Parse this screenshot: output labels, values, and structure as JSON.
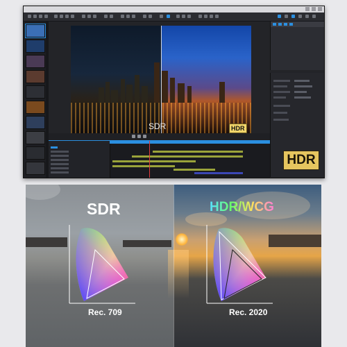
{
  "editor": {
    "menu": [
      "",
      "",
      "",
      "",
      "",
      "",
      "",
      "",
      ""
    ],
    "preview_left_label": "SDR",
    "preview_right_badge": "HDR"
  },
  "corner_badge": "HDR",
  "comparison": {
    "left_title": "SDR",
    "right_title": "HDR/WCG",
    "left_caption": "Rec. 709",
    "right_caption": "Rec. 2020"
  },
  "colors": {
    "accent_blue": "#2b8fe0",
    "hdr_badge": "#e6c55f",
    "clip_yellow": "#9aa33a",
    "clip_blue": "#3b47b5"
  }
}
